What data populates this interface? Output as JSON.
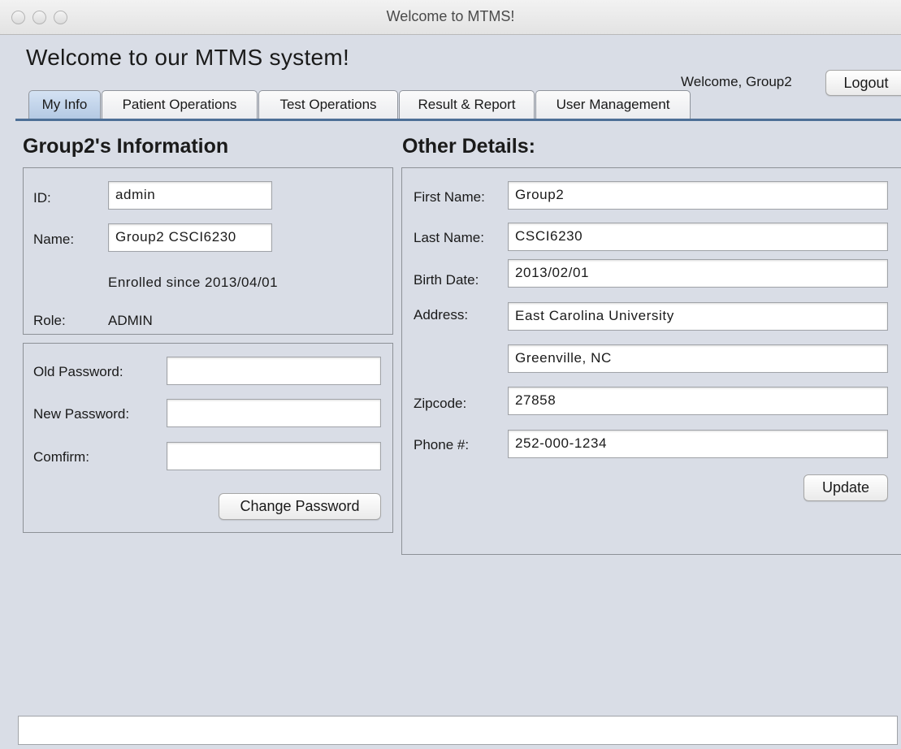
{
  "window": {
    "title": "Welcome to MTMS!"
  },
  "header": {
    "heading": "Welcome to our MTMS system!",
    "welcome_user": "Welcome, Group2",
    "logout_label": "Logout"
  },
  "tabs": [
    {
      "label": "My Info",
      "active": true
    },
    {
      "label": "Patient Operations",
      "active": false
    },
    {
      "label": "Test Operations",
      "active": false
    },
    {
      "label": "Result & Report",
      "active": false
    },
    {
      "label": "User Management",
      "active": false
    }
  ],
  "info": {
    "title": "Group2's Information",
    "id_label": "ID:",
    "id_value": "admin",
    "name_label": "Name:",
    "name_value": "Group2 CSCI6230",
    "enrolled": "Enrolled since 2013/04/01",
    "role_label": "Role:",
    "role_value": "ADMIN"
  },
  "password": {
    "old_label": "Old Password:",
    "old_value": "",
    "new_label": "New Password:",
    "new_value": "",
    "confirm_label": "Comfirm:",
    "confirm_value": "",
    "change_label": "Change Password"
  },
  "details": {
    "title": "Other Details:",
    "first_name_label": "First Name:",
    "first_name": "Group2",
    "last_name_label": "Last Name:",
    "last_name": "CSCI6230",
    "birth_date_label": "Birth Date:",
    "birth_date": "2013/02/01",
    "address_label": "Address:",
    "address_line1": "East Carolina University",
    "address_line2": "Greenville, NC",
    "zipcode_label": "Zipcode:",
    "zipcode": "27858",
    "phone_label": "Phone #:",
    "phone": "252-000-1234",
    "update_label": "Update"
  },
  "status": {
    "text": ""
  }
}
